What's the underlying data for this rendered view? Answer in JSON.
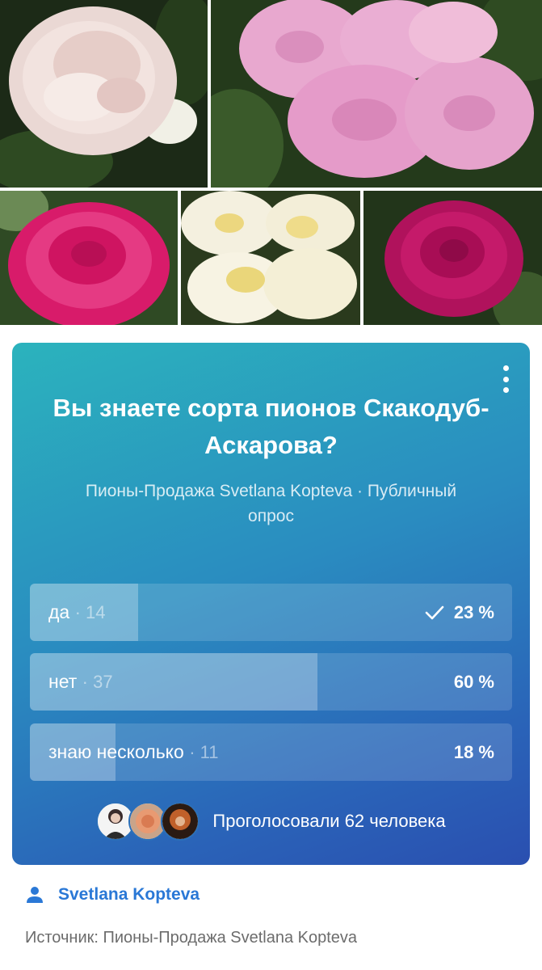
{
  "gallery": {
    "photos": [
      {
        "name": "photo-pale-pink-peony"
      },
      {
        "name": "photo-pink-peonies-cluster"
      },
      {
        "name": "photo-magenta-peony"
      },
      {
        "name": "photo-cream-peonies"
      },
      {
        "name": "photo-crimson-peony"
      }
    ]
  },
  "poll": {
    "title": "Вы знаете сорта пионов Скакодуб-Аскарова?",
    "subtitle": "Пионы-Продажа Svetlana Kopteva · Публичный опрос",
    "options": [
      {
        "label": "да",
        "count": "· 14",
        "percent": "23 %",
        "share": 0.23,
        "selected": true
      },
      {
        "label": "нет",
        "count": "· 37",
        "percent": "60 %",
        "share": 0.6,
        "selected": false
      },
      {
        "label": "знаю несколько",
        "count": "· 11",
        "percent": "18 %",
        "share": 0.18,
        "selected": false
      }
    ],
    "voters_text": "Проголосовали 62 человека",
    "menu_icon": "more-vertical-icon",
    "check_icon": "check-icon"
  },
  "author": {
    "name": "Svetlana Kopteva",
    "icon": "person-icon"
  },
  "source": "Источник: Пионы-Продажа Svetlana Kopteva",
  "colors": {
    "poll_gradient_start": "#2bb3bd",
    "poll_gradient_end": "#2a4fb0",
    "link": "#2a78d6",
    "muted_text": "#6c6c6c"
  }
}
